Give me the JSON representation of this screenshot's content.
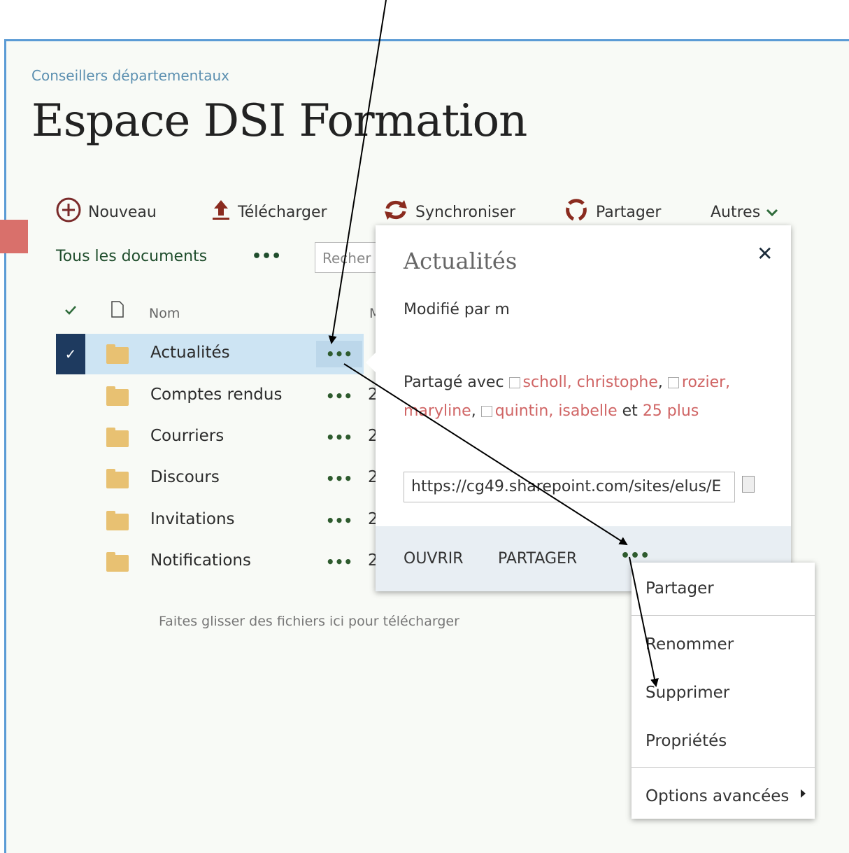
{
  "site": {
    "breadcrumb": "Conseillers départementaux",
    "title": "Espace DSI Formation"
  },
  "toolbar": {
    "new": "Nouveau",
    "upload": "Télécharger",
    "sync": "Synchroniser",
    "share": "Partager",
    "more": "Autres"
  },
  "view": {
    "name": "Tous les documents",
    "dots": "•••",
    "search_placeholder": "Recher"
  },
  "list": {
    "col_name": "Nom",
    "col_modified_initial": "M",
    "items": [
      {
        "name": "Actualités",
        "dots": "•••",
        "extra": ""
      },
      {
        "name": "Comptes rendus",
        "dots": "•••",
        "extra": "2"
      },
      {
        "name": "Courriers",
        "dots": "•••",
        "extra": "2"
      },
      {
        "name": "Discours",
        "dots": "•••",
        "extra": "2"
      },
      {
        "name": "Invitations",
        "dots": "•••",
        "extra": "2"
      },
      {
        "name": "Notifications",
        "dots": "•••",
        "extra": "2"
      }
    ],
    "drop_hint": "Faites glisser des fichiers ici pour télécharger"
  },
  "callout": {
    "title": "Actualités",
    "close": "✕",
    "modified": "Modifié par m",
    "shared_label": "Partagé avec",
    "user1": "scholl, christophe",
    "user2": "rozier, maryline",
    "user3": "quintin, isabelle",
    "and": "et",
    "plus": "25 plus",
    "url": "https://cg49.sharepoint.com/sites/elus/E",
    "open": "OUVRIR",
    "share": "PARTAGER",
    "dots": "•••"
  },
  "menu": {
    "items": [
      "Partager",
      "Renommer",
      "Supprimer",
      "Propriétés",
      "Options avancées"
    ]
  },
  "colors": {
    "frame": "#5b9bd5",
    "selected_row": "#cde4f3",
    "check_bg": "#1e3a5f",
    "shared_user": "#d06565",
    "folder": "#e8c172"
  }
}
